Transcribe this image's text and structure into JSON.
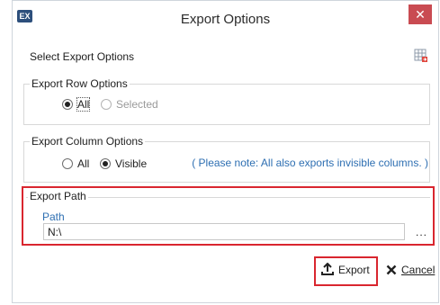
{
  "window": {
    "title": "Export Options",
    "app_icon_label": "EX",
    "close_glyph": "✕"
  },
  "main": {
    "heading": "Select Export Options",
    "grid_icon": "grid-export-icon"
  },
  "row_options": {
    "title": "Export Row Options",
    "all_label": "All",
    "selected_label": "Selected",
    "selected_value": "All"
  },
  "column_options": {
    "title": "Export Column Options",
    "all_label": "All",
    "visible_label": "Visible",
    "selected_value": "Visible",
    "note": "( Please note: All also exports invisible columns. )"
  },
  "export_path": {
    "title": "Export Path",
    "path_label": "Path",
    "path_value": "N:\\",
    "browse_label": "..."
  },
  "buttons": {
    "export_label": "Export",
    "cancel_label": "Cancel"
  },
  "colors": {
    "highlight": "#d9262f",
    "accent_text": "#2e6fb2",
    "close_button": "#c94b52"
  }
}
